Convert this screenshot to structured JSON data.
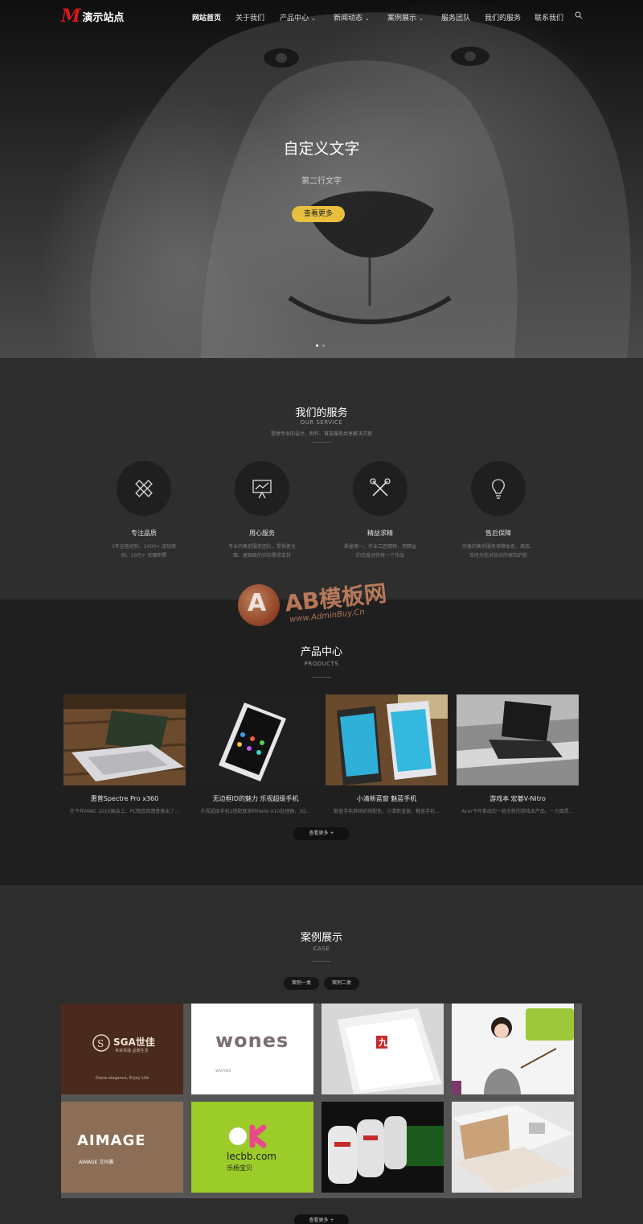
{
  "header": {
    "logo_mark": "M",
    "logo_text": "演示站点",
    "menu": [
      {
        "label": "网站首页",
        "active": true,
        "dropdown": false
      },
      {
        "label": "关于我们",
        "active": false,
        "dropdown": false
      },
      {
        "label": "产品中心",
        "active": false,
        "dropdown": true
      },
      {
        "label": "新闻动态",
        "active": false,
        "dropdown": true
      },
      {
        "label": "案例展示",
        "active": false,
        "dropdown": true
      },
      {
        "label": "服务团队",
        "active": false,
        "dropdown": false
      },
      {
        "label": "我们的服务",
        "active": false,
        "dropdown": false
      },
      {
        "label": "联系我们",
        "active": false,
        "dropdown": false
      }
    ],
    "caret": "⌄",
    "search_icon": "search-icon"
  },
  "hero": {
    "title": "自定义文字",
    "subtitle": "第二行文字",
    "button": "查看更多",
    "button_color": "#e8bf3f",
    "slides": 2,
    "active_slide": 1
  },
  "services": {
    "title": "我们的服务",
    "subtitle_en": "OUR SERVICE",
    "desc": "提供专业的设计、制作、首选服务共享解决方案",
    "items": [
      {
        "icon": "pencil-ruler-icon",
        "name": "专注品质",
        "desc": "3年运营经验、1000+ 成功案例、10万+ 页面积累"
      },
      {
        "icon": "presentation-chart-icon",
        "name": "用心服务",
        "desc": "专业的售前服务团队，提供更全面、更细致的实际需求支持"
      },
      {
        "icon": "tools-icon",
        "name": "精益求精",
        "desc": "质量第一，作业工匠精神，用精益的态度对待每一个作品"
      },
      {
        "icon": "lightbulb-icon",
        "name": "售后保障",
        "desc": "完善的售后服务保障体系，高效、及时为您对站点的保驾护航"
      }
    ]
  },
  "products": {
    "title": "产品中心",
    "subtitle_en": "PRODUCTS",
    "items": [
      {
        "name": "惠普Spectre Pro x360",
        "desc": "在今年MWC 2015展会上，PC制造商惠普推出了..."
      },
      {
        "name": "无边框ID的魅力 乐视超级手机",
        "desc": "乐视超级手机1搭配联发科Helio X10处理器，3G..."
      },
      {
        "name": "小清新蓝窗 魅蓝手机",
        "desc": "魅蓝手机继续延续配色，小清新蓝窗，魅蓝手机..."
      },
      {
        "name": "游戏本 宏碁V-Nitro",
        "desc": "Acer今年推出的一款全新的游戏本产品，一方面是..."
      }
    ],
    "more": "查看更多 +"
  },
  "watermark": {
    "letter": "A",
    "text": "AB模板网",
    "url": "www.AdminBuy.Cn"
  },
  "cases": {
    "title": "案例展示",
    "subtitle_en": "CASE",
    "tabs": [
      "案例一类",
      "案例二类"
    ],
    "more": "查看更多 +",
    "tiles": [
      {
        "kind": "brand",
        "line1": "SGA世佳",
        "line2": "世家高端 品牌生活",
        "line3": "Diane elegance, Enjoy Life"
      },
      {
        "kind": "brand",
        "line1": "wones",
        "line2": "wones"
      },
      {
        "kind": "brochure",
        "line1": "九"
      },
      {
        "kind": "photo",
        "line1": ""
      },
      {
        "kind": "brand",
        "line1": "AIMAGE",
        "line2": "AIMAGE 艾玛雅"
      },
      {
        "kind": "brand",
        "line1": "lecbb.com",
        "line2": "乐杨宝贝"
      },
      {
        "kind": "booth",
        "line1": ""
      },
      {
        "kind": "brochure",
        "line1": ""
      }
    ]
  }
}
